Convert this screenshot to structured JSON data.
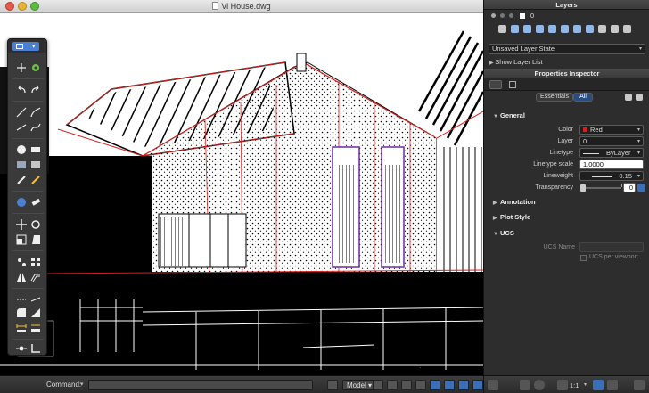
{
  "window": {
    "title": "Vi House.dwg"
  },
  "command": {
    "label": "Command:"
  },
  "statusbar": {
    "model_tab": "Model",
    "scale": "1:1"
  },
  "layers_panel": {
    "title": "Layers",
    "current_layer": "0",
    "layer_state": "Unsaved Layer State",
    "show_layer_list": "Show Layer List"
  },
  "properties_panel": {
    "title": "Properties Inspector",
    "filter_tabs": [
      "Essentials",
      "All"
    ],
    "sections": {
      "general": "General",
      "annotation": "Annotation",
      "plot_style": "Plot Style",
      "ucs": "UCS"
    },
    "general": {
      "color_label": "Color",
      "color_value": "Red",
      "layer_label": "Layer",
      "layer_value": "0",
      "linetype_label": "Linetype",
      "linetype_value": "ByLayer",
      "linetype_scale_label": "Linetype scale",
      "linetype_scale_value": "1.0000",
      "lineweight_label": "Lineweight",
      "lineweight_value": "0.15 mm",
      "transparency_label": "Transparency",
      "transparency_value": "0"
    },
    "ucs": {
      "ucs_name_label": "UCS Name",
      "ucs_per_viewport": "UCS per viewport"
    }
  },
  "colors": {
    "accent": "#3c6fb5",
    "red": "#d62020",
    "panel": "#2d2d2d"
  }
}
